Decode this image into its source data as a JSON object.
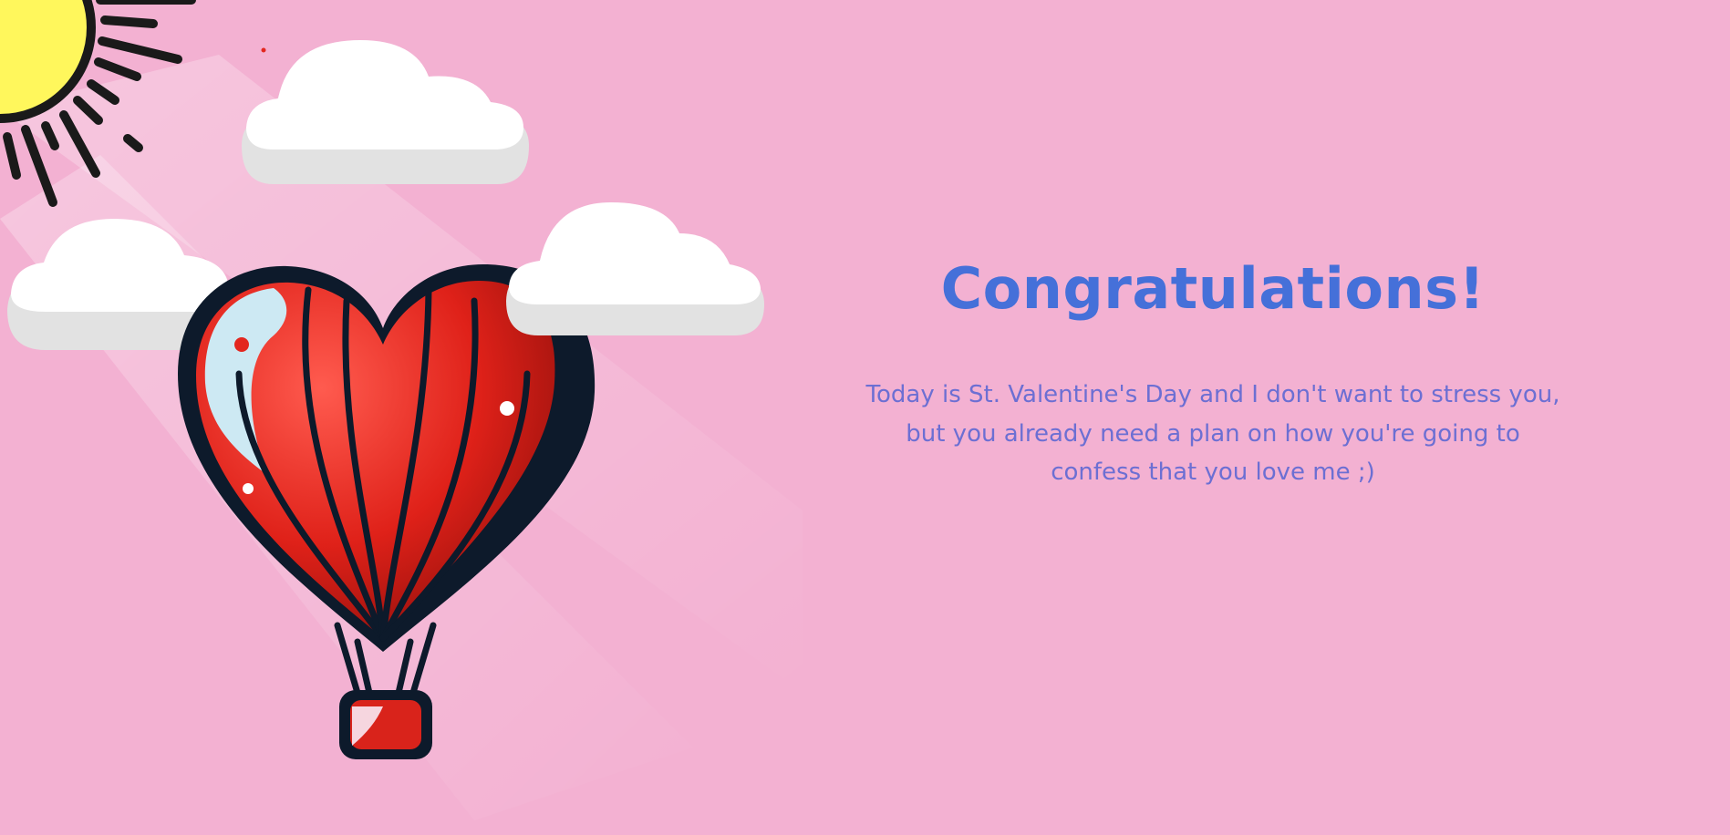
{
  "colors": {
    "background": "#f3b1d2",
    "title": "#4570d9",
    "body": "#6c6fd3",
    "balloon_red": "#e3271f",
    "balloon_outline": "#0d1a2b",
    "sun": "#fff75c",
    "cloud": "#ffffff"
  },
  "illustration": {
    "icons": [
      "sun-icon",
      "cloud-icon",
      "heart-hot-air-balloon-icon"
    ]
  },
  "message": {
    "title": "Congratulations!",
    "body": "Today is St. Valentine's Day and I don't want to stress you, but you already need a plan on how you're going to confess that you love me ;)"
  }
}
